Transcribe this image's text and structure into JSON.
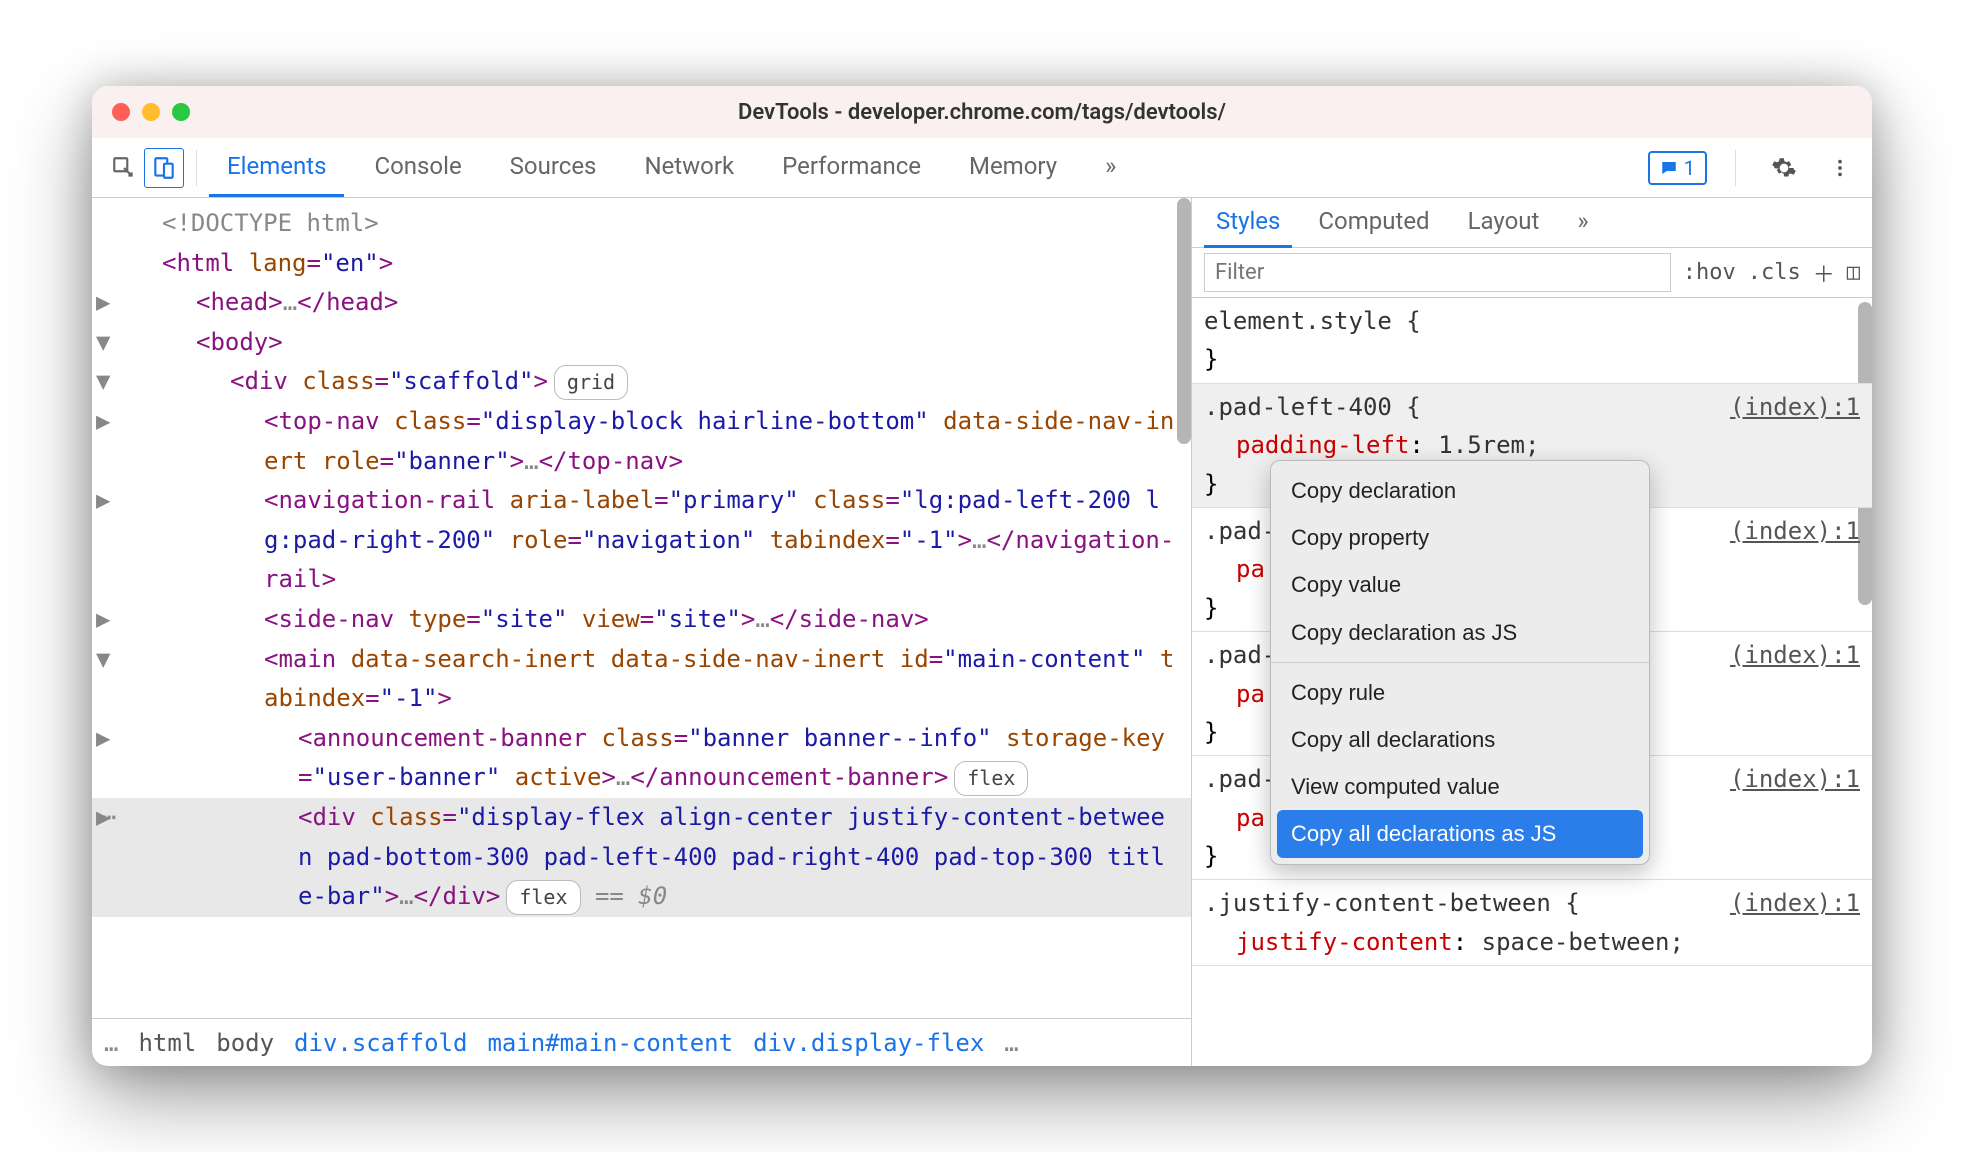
{
  "window": {
    "title": "DevTools - developer.chrome.com/tags/devtools/"
  },
  "toolbar": {
    "tabs": [
      "Elements",
      "Console",
      "Sources",
      "Network",
      "Performance",
      "Memory"
    ],
    "messages_count": "1"
  },
  "dom": {
    "l0": "<!DOCTYPE html>",
    "html_open": {
      "tag": "html",
      "attr": "lang",
      "val": "\"en\""
    },
    "head": {
      "tag": "head"
    },
    "body": {
      "tag": "body"
    },
    "scaffold": {
      "tag": "div",
      "attr": "class",
      "val": "\"scaffold\"",
      "pill": "grid"
    },
    "topnav": {
      "tag": "top-nav",
      "a1n": "class",
      "a1v": "\"display-block hairline-bottom\"",
      "a2n": "data-side-nav-inert",
      "a3n": "role",
      "a3v": "\"banner\""
    },
    "navrail": {
      "tag": "navigation-rail",
      "a1n": "aria-label",
      "a1v": "\"primary\"",
      "a2n": "class",
      "a2v": "\"lg:pad-left-200 lg:pad-right-200\"",
      "a3n": "role",
      "a3v": "\"navigation\"",
      "a4n": "tabindex",
      "a4v": "\"-1\""
    },
    "sidenav": {
      "tag": "side-nav",
      "a1n": "type",
      "a1v": "\"site\"",
      "a2n": "view",
      "a2v": "\"site\""
    },
    "mainel": {
      "tag": "main",
      "a1n": "data-search-inert",
      "a2n": "data-side-nav-inert",
      "a3n": "id",
      "a3v": "\"main-content\"",
      "a4n": "tabindex",
      "a4v": "\"-1\""
    },
    "ann": {
      "tag": "announcement-banner",
      "a1n": "class",
      "a1v": "\"banner banner--info\"",
      "a2n": "storage-key",
      "a2v": "\"user-banner\"",
      "a3n": "active",
      "pill": "flex"
    },
    "seldiv": {
      "tag": "div",
      "a1n": "class",
      "a1v": "\"display-flex align-center justify-content-between pad-bottom-300 pad-left-400 pad-right-400 pad-top-300 title-bar\"",
      "pill": "flex",
      "eq": "== $0"
    }
  },
  "breadcrumb": {
    "ell_left": "…",
    "items": [
      "html",
      "body",
      "div.scaffold",
      "main#main-content",
      "div.display-flex"
    ],
    "ell_right": "…"
  },
  "styles": {
    "tabs": [
      "Styles",
      "Computed",
      "Layout"
    ],
    "filter_placeholder": "Filter",
    "hov": ":hov",
    "cls": ".cls",
    "el_style_open": "element.style {",
    "close": "}",
    "rules": [
      {
        "sel": ".pad-left-400 {",
        "prop": "padding-left",
        "val": "1.5rem;",
        "src": "(index):1"
      },
      {
        "sel": ".pad-",
        "prop": "pa",
        "val": "",
        "src": "(index):1"
      },
      {
        "sel": ".pad-",
        "prop": "pa",
        "val": "",
        "src": "(index):1"
      },
      {
        "sel": ".pad-",
        "prop": "pa",
        "val": "",
        "src": "(index):1"
      },
      {
        "sel": ".justify-content-between {",
        "prop": "justify-content",
        "val": "space-between;",
        "src": "(index):1"
      }
    ]
  },
  "context_menu": {
    "items": [
      "Copy declaration",
      "Copy property",
      "Copy value",
      "Copy declaration as JS"
    ],
    "items2": [
      "Copy rule",
      "Copy all declarations",
      "View computed value"
    ],
    "highlight": "Copy all declarations as JS"
  }
}
